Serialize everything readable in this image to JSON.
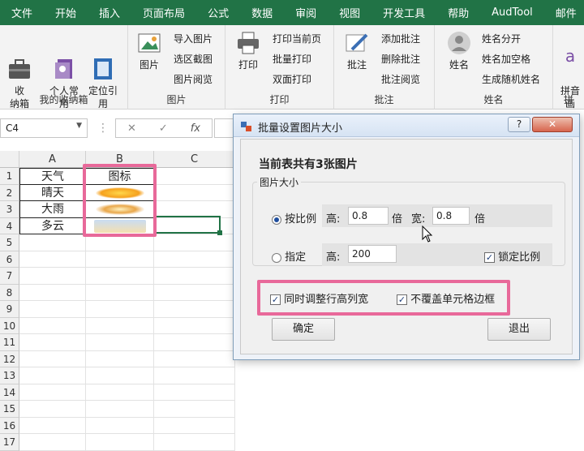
{
  "menu": [
    "文件",
    "开始",
    "插入",
    "页面布局",
    "公式",
    "数据",
    "审阅",
    "视图",
    "开发工具",
    "帮助",
    "AudTool",
    "邮件"
  ],
  "ribbon": {
    "group1": {
      "label": "我的收纳箱",
      "btn1": "收\n纳箱",
      "btn2": "个人常\n用",
      "btn3": "定位引\n用"
    },
    "group2": {
      "label": "图片",
      "big": "图片",
      "items": [
        "导入图片",
        "选区截图",
        "图片阅览"
      ]
    },
    "group3": {
      "label": "打印",
      "big": "打印",
      "items": [
        "打印当前页",
        "批量打印",
        "双面打印"
      ]
    },
    "group4": {
      "label": "批注",
      "big": "批注",
      "items": [
        "添加批注",
        "删除批注",
        "批注阅览"
      ]
    },
    "group5": {
      "label": "姓名",
      "big": "姓名",
      "items": [
        "姓名分开",
        "姓名加空格",
        "生成随机姓名"
      ]
    },
    "group6": {
      "label": "拼音",
      "big": "拼音\n画",
      "last": "拼"
    }
  },
  "formula": {
    "namebox": "C4",
    "cancel": "✕",
    "confirm": "✓",
    "fx": "fx"
  },
  "sheet": {
    "columns": [
      "A",
      "B",
      "C"
    ],
    "rows": [
      "1",
      "2",
      "3",
      "4",
      "5",
      "6",
      "7",
      "8",
      "9",
      "10",
      "11",
      "12",
      "13",
      "14",
      "15",
      "16",
      "17"
    ],
    "a_values": [
      "天气",
      "晴天",
      "大雨",
      "多云"
    ],
    "b1": "图标"
  },
  "dialog": {
    "title": "批量设置图片大小",
    "help": "?",
    "close": "✕",
    "heading": "当前表共有3张图片",
    "group": "图片大小",
    "ratio_label": "按比例",
    "high": "高:",
    "high_val": "0.8",
    "times": "倍",
    "wide": "宽:",
    "wide_val": "0.8",
    "times2": "倍",
    "fixed_label": "指定",
    "high2": "高:",
    "high2_val": "200",
    "lock": "锁定比例",
    "adjust": "同时调整行高列宽",
    "nocover": "不覆盖单元格边框",
    "ok": "确定",
    "exit": "退出"
  }
}
